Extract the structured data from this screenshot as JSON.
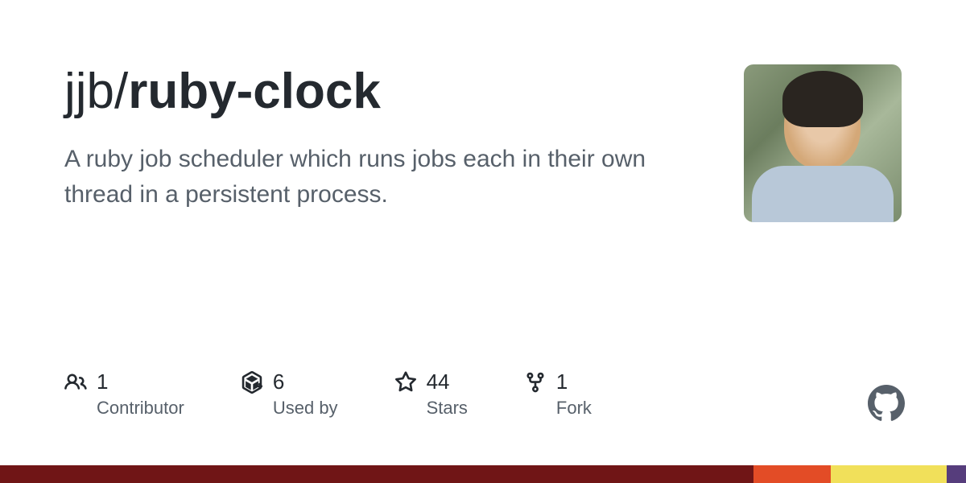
{
  "repo": {
    "owner": "jjb",
    "separator": "/",
    "name": "ruby-clock",
    "description": "A ruby job scheduler which runs jobs each in their own thread in a persistent process."
  },
  "stats": [
    {
      "icon": "people-icon",
      "count": "1",
      "label": "Contributor"
    },
    {
      "icon": "package-icon",
      "count": "6",
      "label": "Used by"
    },
    {
      "icon": "star-icon",
      "count": "44",
      "label": "Stars"
    },
    {
      "icon": "fork-icon",
      "count": "1",
      "label": "Fork"
    }
  ],
  "footer_segments": [
    {
      "color": "#701516",
      "width": "78%"
    },
    {
      "color": "#e34c26",
      "width": "8%"
    },
    {
      "color": "#f1e05a",
      "width": "12%"
    },
    {
      "color": "#563d7c",
      "width": "2%"
    }
  ]
}
